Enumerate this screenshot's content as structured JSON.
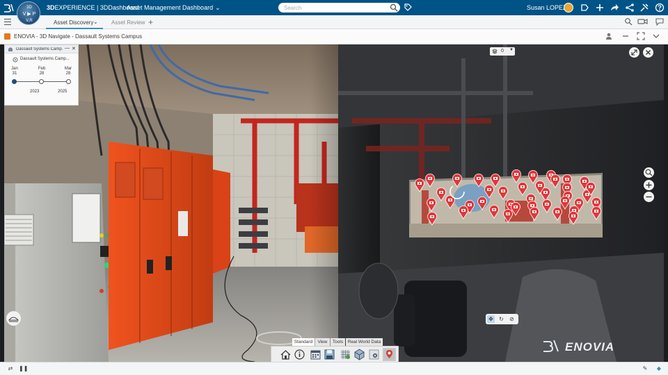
{
  "topbar": {
    "compass": {
      "top": "3D",
      "left": "V",
      "right": "P",
      "bottom": "V,R",
      "center": "▶"
    },
    "brand_bold": "3D",
    "brand_rest": "EXPERIENCE | 3DDashboard",
    "dashboard_title": "Asset Management Dashboard",
    "search_placeholder": "Search",
    "username": "Susan LOPEZ",
    "icons": [
      "search-icon",
      "tag-icon",
      "notifications-icon",
      "add-icon",
      "share-icon",
      "network-icon",
      "tools-icon",
      "help-icon"
    ]
  },
  "tabs": {
    "items": [
      {
        "label": "Asset Discovery",
        "active": true
      },
      {
        "label": "Asset Review",
        "active": false
      }
    ],
    "add_label": "+"
  },
  "widget": {
    "title": "ENOVIA - 3D Navigate - Dassault Systems Campus"
  },
  "timeline": {
    "title": "Dassault Systems Camp...",
    "item_label": "Dassault Systems Camp...",
    "dates": [
      {
        "month": "Jan",
        "day": "31"
      },
      {
        "month": "Feb",
        "day": "28"
      },
      {
        "month": "Mar",
        "day": "28"
      }
    ],
    "years": [
      "2023",
      "2025"
    ]
  },
  "viewer": {
    "layer_value": "0",
    "action_tabs": [
      "Standard",
      "View",
      "Tools",
      "Real World Data"
    ],
    "action_buttons": [
      "home-icon",
      "info-icon",
      "calendar-icon",
      "save-view-icon",
      "grid-icon",
      "cube-icon",
      "settings-icon",
      "pin-icon"
    ],
    "brand": "ENOVIA",
    "photo_markers": 42
  },
  "colors": {
    "topbar": "#005386",
    "accent": "#368ec4",
    "marker": "#e0383a",
    "machinery": "#e44c1f"
  }
}
